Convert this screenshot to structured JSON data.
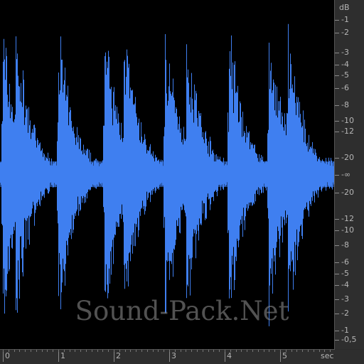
{
  "colors": {
    "waveform": "#3f7ff0",
    "background": "#000000",
    "ruler": "#2e2e2e",
    "ruler_text": "#b5b5b5"
  },
  "db_ruler": {
    "unit": "dB",
    "upper_labels": [
      "-1",
      "-2",
      "-3",
      "-4",
      "-5",
      "-6",
      "-8",
      "-10",
      "-12",
      "-20"
    ],
    "center_label": "-∞",
    "lower_labels": [
      "-20",
      "-12",
      "-10",
      "-8",
      "-6",
      "-5",
      "-4",
      "-3",
      "-2",
      "-1",
      "-0,5"
    ]
  },
  "time_ruler": {
    "labels": [
      "0",
      "1",
      "2",
      "3",
      "4",
      "5"
    ],
    "unit": "sec"
  },
  "watermark": "Sound-Pack.Net"
}
